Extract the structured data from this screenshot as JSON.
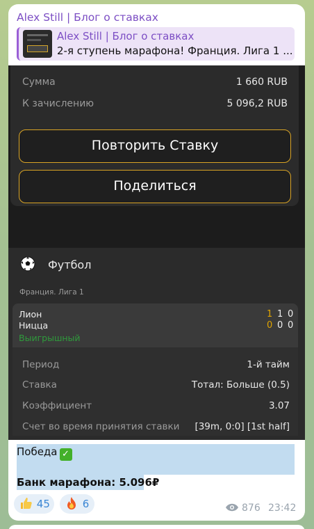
{
  "channel": {
    "name": "Alex Still | Блог о ставках"
  },
  "reply": {
    "title": "Alex Still | Блог о ставках",
    "text": "2-я ступень марафона! Франция. Лига 1 ..."
  },
  "bet_summary": {
    "rows": [
      {
        "label": "Сумма",
        "value": "1 660 RUB"
      },
      {
        "label": "К зачислению",
        "value": "5 096,2 RUB"
      }
    ],
    "buttons": {
      "repeat_label": "Повторить Ставку",
      "share_label": "Поделиться"
    }
  },
  "event": {
    "sport": "Футбол",
    "league": "Франция. Лига 1",
    "teams": [
      {
        "name": "Лион",
        "scores": [
          "1",
          "1",
          "0"
        ]
      },
      {
        "name": "Ницца",
        "scores": [
          "0",
          "0",
          "0"
        ]
      }
    ],
    "status": "Выигрышный",
    "details": [
      {
        "label": "Период",
        "value": "1-й тайм"
      },
      {
        "label": "Ставка",
        "value": "Тотал: Больше (0.5)"
      },
      {
        "label": "Коэффициент",
        "value": "3.07"
      },
      {
        "label": "Счет во время принятия ставки",
        "value": "[39m, 0:0] [1st half]"
      }
    ]
  },
  "message": {
    "line1": "Победа",
    "line1_emoji": "✓",
    "line2": "Банк марафона: 5.096₽"
  },
  "reactions": [
    {
      "icon": "thumbs-up",
      "count": "45"
    },
    {
      "icon": "fire",
      "count": "6"
    }
  ],
  "meta": {
    "views": "876",
    "time": "23:42"
  },
  "colors": {
    "accent_purple": "#7c4ec4",
    "button_border": "#d9a425",
    "win_green": "#2f9b3c",
    "score_highlight": "#e0a400",
    "reaction_blue": "#3a86d4"
  }
}
